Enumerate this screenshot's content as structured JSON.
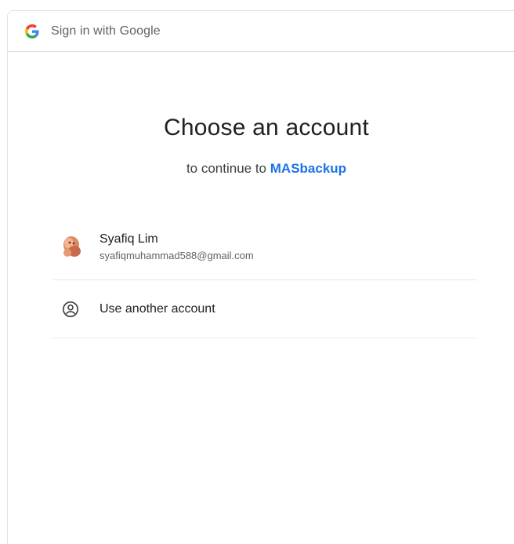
{
  "header": {
    "logo_icon": "google-g-icon",
    "title": "Sign in with Google"
  },
  "main": {
    "title": "Choose an account",
    "subtitle_prefix": "to continue to ",
    "app_name": "MASbackup"
  },
  "accounts": [
    {
      "name": "Syafiq Lim",
      "email": "syafiqmuhammad588@gmail.com",
      "avatar_icon": "profile-avatar"
    }
  ],
  "use_another": {
    "label": "Use another account",
    "icon": "account-circle-icon"
  },
  "colors": {
    "accent": "#1a73e8",
    "text": "#202124",
    "secondary_text": "#5f6368",
    "divider": "#e8eaed"
  }
}
